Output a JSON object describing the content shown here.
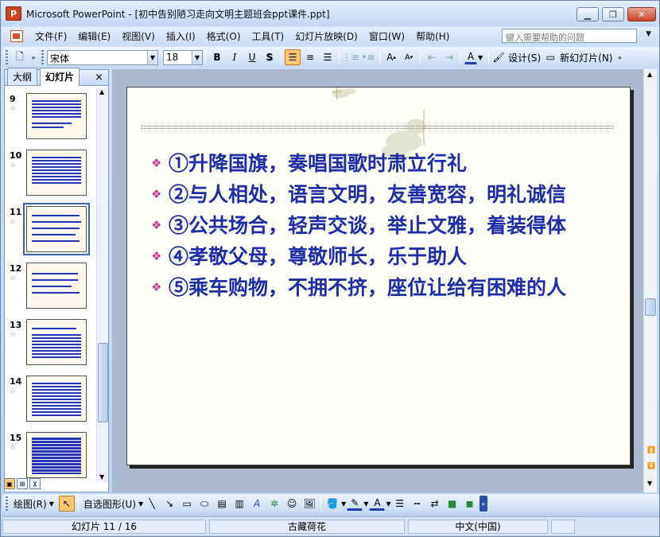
{
  "titlebar": {
    "app_name": "Microsoft PowerPoint",
    "doc_title": "Microsoft PowerPoint - [初中告别陋习走向文明主题班会ppt课件.ppt]",
    "app_icon_label": "P"
  },
  "window_controls": {
    "minimize": "minimize-icon",
    "restore": "restore-icon",
    "close": "close-icon"
  },
  "menu": {
    "items": [
      "文件(F)",
      "编辑(E)",
      "视图(V)",
      "插入(I)",
      "格式(O)",
      "工具(T)",
      "幻灯片放映(D)",
      "窗口(W)",
      "帮助(H)"
    ],
    "help_placeholder": "键入需要帮助的问题"
  },
  "toolbar": {
    "font_name": "宋体",
    "font_size": "18",
    "bold": "B",
    "italic": "I",
    "underline": "U",
    "shadow": "S",
    "design_label": "设计(S)",
    "new_slide_label": "新幻灯片(N)",
    "font_color": "#1f3cb8"
  },
  "left_panel": {
    "tabs": [
      "大纲",
      "幻灯片"
    ],
    "active_tab": "幻灯片",
    "close": "×",
    "thumbnails": [
      {
        "num": "9"
      },
      {
        "num": "10"
      },
      {
        "num": "11",
        "selected": true
      },
      {
        "num": "12"
      },
      {
        "num": "13"
      },
      {
        "num": "14"
      },
      {
        "num": "15"
      }
    ]
  },
  "slide": {
    "bullets": [
      "①升降国旗，奏唱国歌时肃立行礼",
      "②与人相处，语言文明，友善宽容，明礼诚信",
      "③公共场合，轻声交谈，举止文雅，着装得体",
      "④孝敬父母，尊敬师长，乐于助人",
      "⑤乘车购物，不拥不挤，座位让给有困难的人"
    ],
    "bullet_symbol": "❖",
    "text_color": "#1f2ea8",
    "bullet_color": "#c0398f"
  },
  "drawbar": {
    "draw_label": "绘图(R)",
    "autoshapes_label": "自选图形(U)"
  },
  "status": {
    "slide_info": "幻灯片 11 / 16",
    "design": "古藏荷花",
    "language": "中文(中国)"
  }
}
